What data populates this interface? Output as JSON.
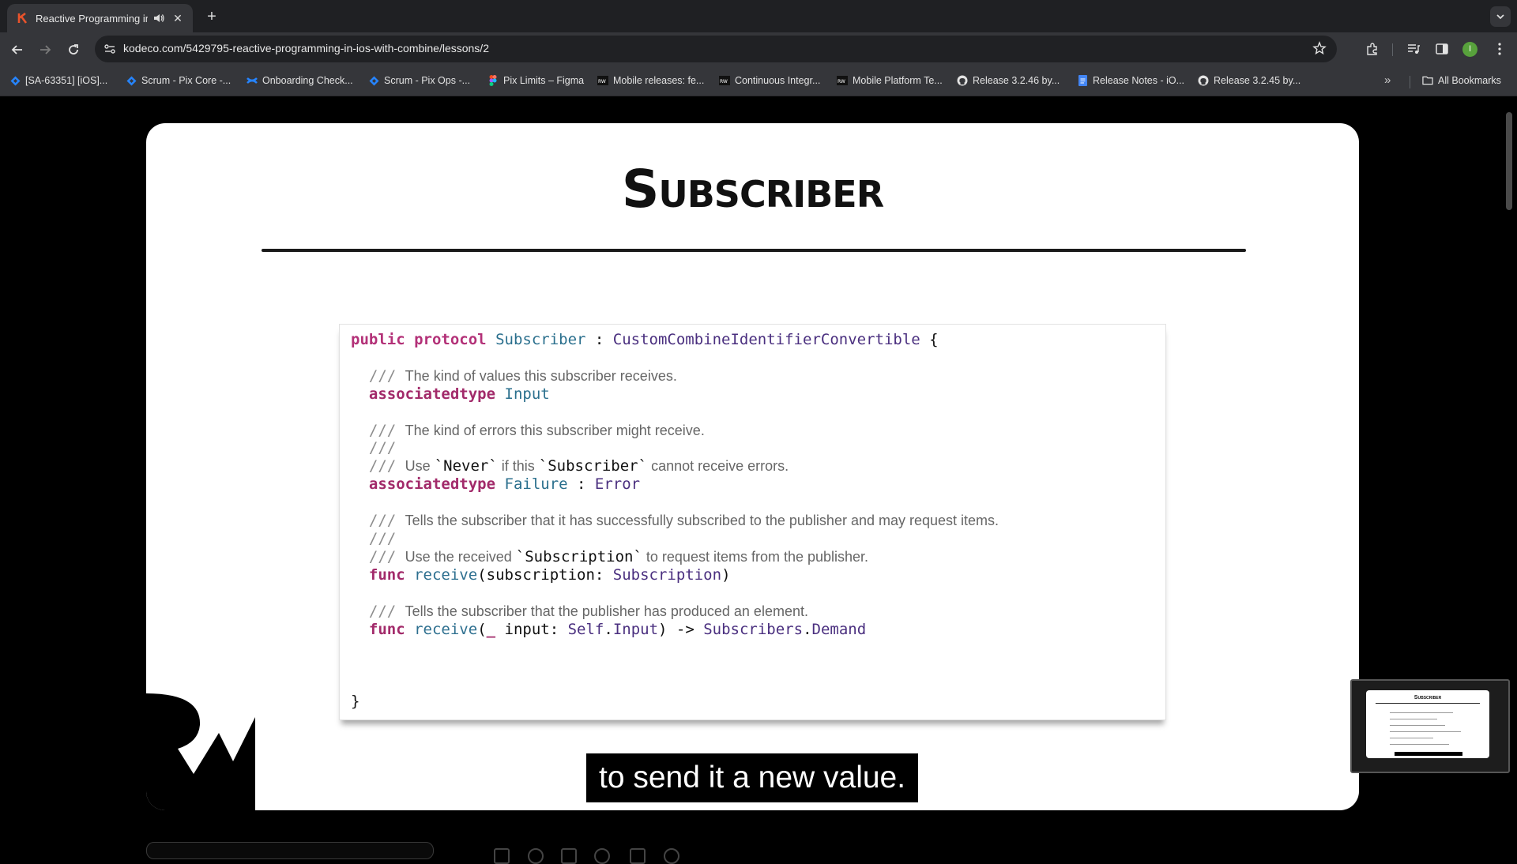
{
  "browser": {
    "tab": {
      "title": "Reactive Programming in iOS with Combine"
    },
    "url": "kodeco.com/5429795-reactive-programming-in-ios-with-combine/lessons/2",
    "profile_initial": "I",
    "bookmarks": [
      {
        "label": "[SA-63351] [iOS]...",
        "icon": "jira-icon"
      },
      {
        "label": "Scrum - Pix Core -...",
        "icon": "jira-icon"
      },
      {
        "label": "Onboarding Check...",
        "icon": "confluence-icon"
      },
      {
        "label": "Scrum - Pix Ops -...",
        "icon": "jira-icon"
      },
      {
        "label": "Pix Limits – Figma",
        "icon": "figma-icon"
      },
      {
        "label": "Mobile releases: fe...",
        "icon": "rw-icon"
      },
      {
        "label": "Continuous Integr...",
        "icon": "rw-icon"
      },
      {
        "label": "Mobile Platform Te...",
        "icon": "rw-icon"
      },
      {
        "label": "Release 3.2.46 by...",
        "icon": "github-icon"
      },
      {
        "label": "Release Notes - iO...",
        "icon": "docs-icon"
      },
      {
        "label": "Release 3.2.45 by...",
        "icon": "github-icon"
      }
    ],
    "all_bookmarks": "All Bookmarks"
  },
  "slide": {
    "title": "Subscriber",
    "code": {
      "l1": {
        "kw1": "public",
        "kw2": "protocol",
        "name": "Subscriber",
        "colon": " : ",
        "parent": "CustomCombineIdentifierConvertible",
        "brace": " {"
      },
      "c1": "The kind of values this subscriber receives.",
      "l2": {
        "kw": "associatedtype",
        "name": "Input"
      },
      "c2": "The kind of errors this subscriber might receive.",
      "c3a": "Use ",
      "c3b": "`Never`",
      "c3c": " if this ",
      "c3d": "`Subscriber`",
      "c3e": " cannot receive errors.",
      "l3": {
        "kw": "associatedtype",
        "name": "Failure",
        "sep": " : ",
        "type": "Error"
      },
      "c4": "Tells the subscriber that it has successfully subscribed to the publisher and may request items.",
      "c5a": "Use the received ",
      "c5b": "`Subscription`",
      "c5c": " to request items from the publisher.",
      "l4": {
        "kw": "func",
        "name": "receive",
        "args_a": "(subscription: ",
        "args_type": "Subscription",
        "args_b": ")"
      },
      "c6": "Tells the subscriber that the publisher has produced an element.",
      "l5": {
        "kw": "func",
        "name": "receive",
        "a": "(",
        "underscore": "_",
        "b": " input: ",
        "self": "Self",
        "dot": ".",
        "input": "Input",
        "c": ") -> ",
        "subs": "Subscribers",
        "dot2": ".",
        "demand": "Demand"
      },
      "comment_marker": "///",
      "close": "}"
    },
    "caption": "to send it a new value."
  },
  "colors": {
    "keyword": "#b33178",
    "type": "#2a6f8d",
    "comment": "#8d8d8d",
    "accent": "#e8532b"
  }
}
